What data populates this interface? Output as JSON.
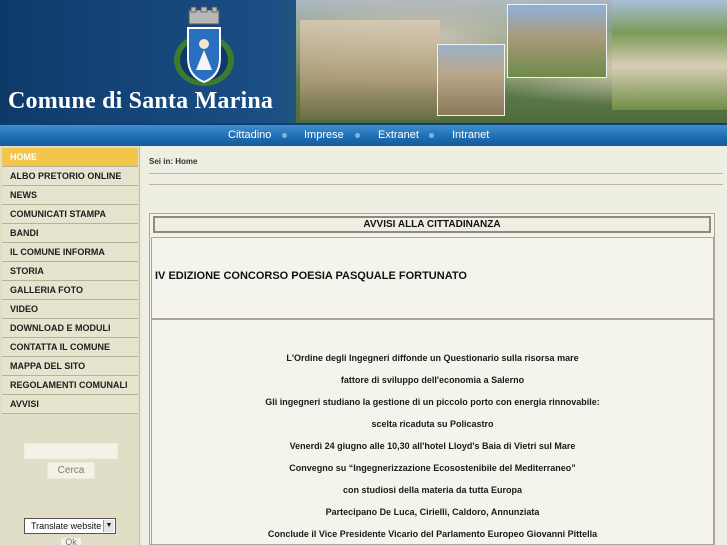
{
  "header": {
    "title": "Comune di Santa Marina",
    "crest_icon": "municipal-crest-icon"
  },
  "topnav": {
    "items": [
      "Cittadino",
      "Imprese",
      "Extranet",
      "Intranet"
    ]
  },
  "sidebar": {
    "items": [
      {
        "label": "HOME",
        "active": true
      },
      {
        "label": "ALBO PRETORIO ONLINE"
      },
      {
        "label": "NEWS"
      },
      {
        "label": "COMUNICATI STAMPA"
      },
      {
        "label": "BANDI"
      },
      {
        "label": "IL COMUNE INFORMA"
      },
      {
        "label": "STORIA"
      },
      {
        "label": "GALLERIA FOTO"
      },
      {
        "label": "VIDEO"
      },
      {
        "label": "DOWNLOAD E MODULI"
      },
      {
        "label": "CONTATTA IL COMUNE"
      },
      {
        "label": "MAPPA DEL SITO"
      },
      {
        "label": "REGOLAMENTI COMUNALI"
      },
      {
        "label": "AVVISI"
      }
    ],
    "search_value": "",
    "search_button": "Cerca",
    "translate_label": "Translate website",
    "ok_button": "Ok"
  },
  "main": {
    "breadcrumb": "Sei in: Home",
    "section_title": "AVVISI ALLA CITTADINANZA",
    "news_title": "IV EDIZIONE CONCORSO POESIA PASQUALE FORTUNATO",
    "body_lines": [
      "L'Ordine degli Ingegneri diffonde un Questionario sulla risorsa mare",
      "fattore di sviluppo dell'economia a Salerno",
      "Gli ingegneri studiano la gestione di un piccolo porto con energia rinnovabile:",
      "scelta ricaduta su Policastro",
      "Venerdì 24 giugno alle 10,30 all'hotel Lloyd's Baia di Vietri sul Mare",
      "Convegno su “Ingegnerizzazione Ecosostenibile del Mediterraneo”",
      "con studiosi della materia da tutta Europa",
      "Partecipano De Luca, Cirielli, Caldoro, Annunziata",
      "Conclude il Vice Presidente Vicario del Parlamento Europeo Giovanni Pittella"
    ]
  },
  "colors": {
    "nav_blue": "#1f6eb4",
    "active_menu": "#f2c64a",
    "sidebar_bg": "#e1dec8"
  }
}
